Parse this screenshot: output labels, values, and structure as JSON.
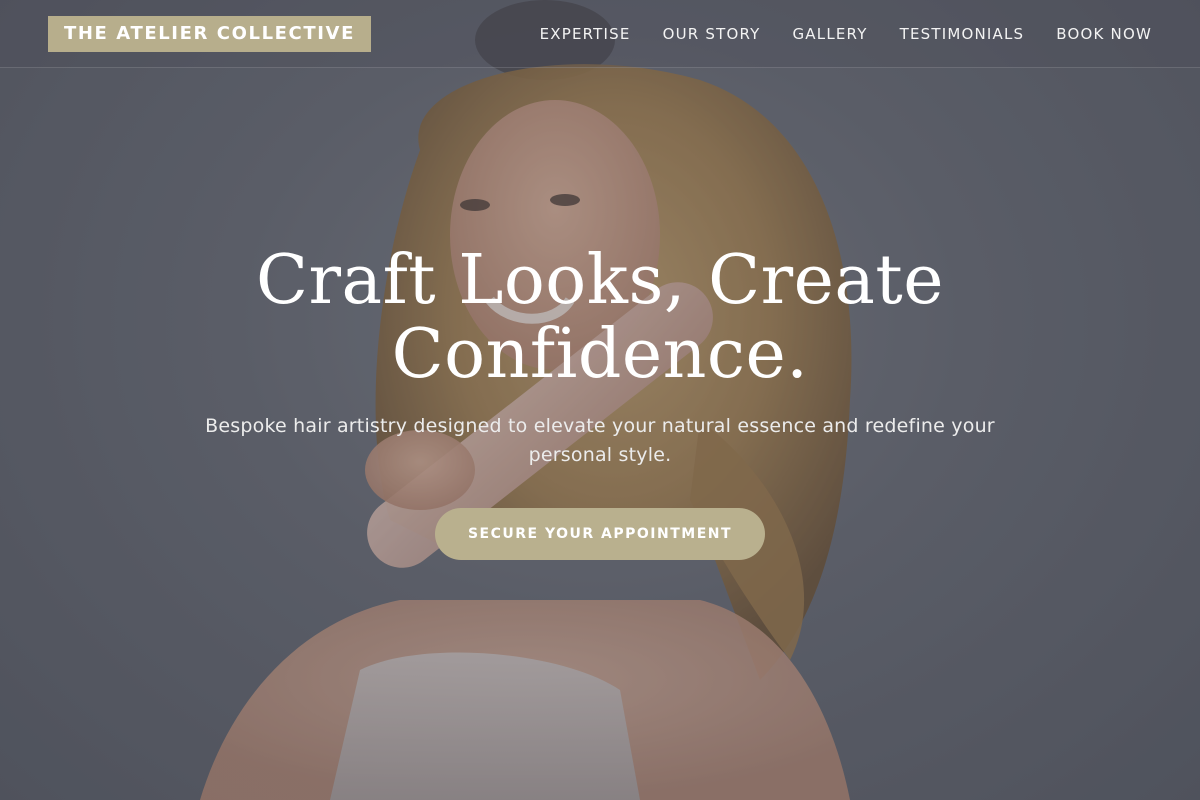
{
  "header": {
    "logo_text": "THE ATELIER COLLECTIVE",
    "nav": [
      {
        "label": "EXPERTISE"
      },
      {
        "label": "OUR STORY"
      },
      {
        "label": "GALLERY"
      },
      {
        "label": "TESTIMONIALS"
      },
      {
        "label": "BOOK NOW"
      }
    ]
  },
  "hero": {
    "headline": "Craft Looks, Create Confidence.",
    "subtext": "Bespoke hair artistry designed to elevate your natural essence and redefine your personal style.",
    "cta_label": "SECURE YOUR APPOINTMENT"
  },
  "colors": {
    "accent": "#b9b08e",
    "background": "#5b5f69",
    "text": "#ffffff"
  }
}
